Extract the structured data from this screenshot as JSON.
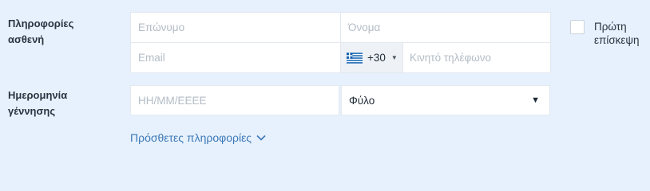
{
  "patient_info": {
    "label_line1": "Πληροφορίες",
    "label_line2": "ασθενή",
    "surname_placeholder": "Επώνυμο",
    "name_placeholder": "Όνομα",
    "email_placeholder": "Email",
    "phone_country_code": "+30",
    "phone_country_icon": "greece-flag-icon",
    "phone_placeholder": "Κινητό τηλέφωνο",
    "first_visit_line1": "Πρώτη",
    "first_visit_line2": "επίσκεψη",
    "first_visit_checked": false
  },
  "birth": {
    "label_line1": "Ημερομηνία",
    "label_line2": "γέννησης",
    "date_placeholder": "HH/MM/EEEE",
    "gender_value": "Φύλο"
  },
  "more_info_link": "Πρόσθετες πληροφορίες",
  "colors": {
    "background": "#e7f1fd",
    "link": "#3b78b6",
    "flag_blue": "#0d5eaf"
  }
}
